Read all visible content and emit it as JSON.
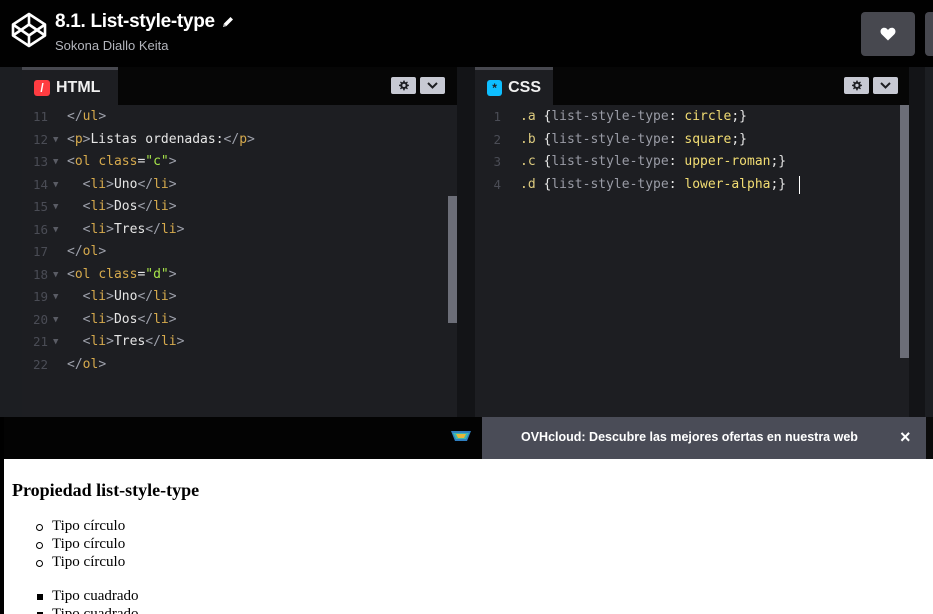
{
  "header": {
    "title": "8.1. List-style-type",
    "author": "Sokona Diallo Keita",
    "heart_icon": "heart-icon",
    "edit_icon": "pencil-icon"
  },
  "html_pane": {
    "tab_label": "HTML",
    "lines": [
      {
        "n": "11",
        "fold": false,
        "tokens": [
          {
            "t": "tag",
            "v": "</"
          },
          {
            "t": "name",
            "v": "ul"
          },
          {
            "t": "tag",
            "v": ">"
          }
        ]
      },
      {
        "n": "12",
        "fold": true,
        "tokens": [
          {
            "t": "tag",
            "v": "<"
          },
          {
            "t": "name",
            "v": "p"
          },
          {
            "t": "tag",
            "v": ">"
          },
          {
            "t": "plain",
            "v": "Listas ordenadas:"
          },
          {
            "t": "tag",
            "v": "</"
          },
          {
            "t": "name",
            "v": "p"
          },
          {
            "t": "tag",
            "v": ">"
          }
        ]
      },
      {
        "n": "13",
        "fold": true,
        "tokens": [
          {
            "t": "tag",
            "v": "<"
          },
          {
            "t": "name",
            "v": "ol"
          },
          {
            "t": "plain",
            "v": " "
          },
          {
            "t": "attr",
            "v": "class"
          },
          {
            "t": "plain",
            "v": "="
          },
          {
            "t": "str",
            "v": "\"c\""
          },
          {
            "t": "tag",
            "v": ">"
          }
        ]
      },
      {
        "n": "14",
        "fold": true,
        "tokens": [
          {
            "t": "plain",
            "v": "  "
          },
          {
            "t": "tag",
            "v": "<"
          },
          {
            "t": "name",
            "v": "li"
          },
          {
            "t": "tag",
            "v": ">"
          },
          {
            "t": "plain",
            "v": "Uno"
          },
          {
            "t": "tag",
            "v": "</"
          },
          {
            "t": "name",
            "v": "li"
          },
          {
            "t": "tag",
            "v": ">"
          }
        ]
      },
      {
        "n": "15",
        "fold": true,
        "tokens": [
          {
            "t": "plain",
            "v": "  "
          },
          {
            "t": "tag",
            "v": "<"
          },
          {
            "t": "name",
            "v": "li"
          },
          {
            "t": "tag",
            "v": ">"
          },
          {
            "t": "plain",
            "v": "Dos"
          },
          {
            "t": "tag",
            "v": "</"
          },
          {
            "t": "name",
            "v": "li"
          },
          {
            "t": "tag",
            "v": ">"
          }
        ]
      },
      {
        "n": "16",
        "fold": true,
        "tokens": [
          {
            "t": "plain",
            "v": "  "
          },
          {
            "t": "tag",
            "v": "<"
          },
          {
            "t": "name",
            "v": "li"
          },
          {
            "t": "tag",
            "v": ">"
          },
          {
            "t": "plain",
            "v": "Tres"
          },
          {
            "t": "tag",
            "v": "</"
          },
          {
            "t": "name",
            "v": "li"
          },
          {
            "t": "tag",
            "v": ">"
          }
        ]
      },
      {
        "n": "17",
        "fold": false,
        "tokens": [
          {
            "t": "tag",
            "v": "</"
          },
          {
            "t": "name",
            "v": "ol"
          },
          {
            "t": "tag",
            "v": ">"
          }
        ]
      },
      {
        "n": "18",
        "fold": true,
        "tokens": [
          {
            "t": "tag",
            "v": "<"
          },
          {
            "t": "name",
            "v": "ol"
          },
          {
            "t": "plain",
            "v": " "
          },
          {
            "t": "attr",
            "v": "class"
          },
          {
            "t": "plain",
            "v": "="
          },
          {
            "t": "str",
            "v": "\"d\""
          },
          {
            "t": "tag",
            "v": ">"
          }
        ]
      },
      {
        "n": "19",
        "fold": true,
        "tokens": [
          {
            "t": "plain",
            "v": "  "
          },
          {
            "t": "tag",
            "v": "<"
          },
          {
            "t": "name",
            "v": "li"
          },
          {
            "t": "tag",
            "v": ">"
          },
          {
            "t": "plain",
            "v": "Uno"
          },
          {
            "t": "tag",
            "v": "</"
          },
          {
            "t": "name",
            "v": "li"
          },
          {
            "t": "tag",
            "v": ">"
          }
        ]
      },
      {
        "n": "20",
        "fold": true,
        "tokens": [
          {
            "t": "plain",
            "v": "  "
          },
          {
            "t": "tag",
            "v": "<"
          },
          {
            "t": "name",
            "v": "li"
          },
          {
            "t": "tag",
            "v": ">"
          },
          {
            "t": "plain",
            "v": "Dos"
          },
          {
            "t": "tag",
            "v": "</"
          },
          {
            "t": "name",
            "v": "li"
          },
          {
            "t": "tag",
            "v": ">"
          }
        ]
      },
      {
        "n": "21",
        "fold": true,
        "tokens": [
          {
            "t": "plain",
            "v": "  "
          },
          {
            "t": "tag",
            "v": "<"
          },
          {
            "t": "name",
            "v": "li"
          },
          {
            "t": "tag",
            "v": ">"
          },
          {
            "t": "plain",
            "v": "Tres"
          },
          {
            "t": "tag",
            "v": "</"
          },
          {
            "t": "name",
            "v": "li"
          },
          {
            "t": "tag",
            "v": ">"
          }
        ]
      },
      {
        "n": "22",
        "fold": false,
        "tokens": [
          {
            "t": "tag",
            "v": "</"
          },
          {
            "t": "name",
            "v": "ol"
          },
          {
            "t": "tag",
            "v": ">"
          }
        ]
      }
    ]
  },
  "css_pane": {
    "tab_label": "CSS",
    "lines": [
      {
        "n": "1",
        "tokens": [
          {
            "t": "sel",
            "v": ".a"
          },
          {
            "t": "plain",
            "v": " {"
          },
          {
            "t": "prop",
            "v": "list-style-type"
          },
          {
            "t": "plain",
            "v": ": "
          },
          {
            "t": "val",
            "v": "circle"
          },
          {
            "t": "plain",
            "v": ";}"
          }
        ]
      },
      {
        "n": "2",
        "tokens": [
          {
            "t": "sel",
            "v": ".b"
          },
          {
            "t": "plain",
            "v": " {"
          },
          {
            "t": "prop",
            "v": "list-style-type"
          },
          {
            "t": "plain",
            "v": ": "
          },
          {
            "t": "val",
            "v": "square"
          },
          {
            "t": "plain",
            "v": ";}"
          }
        ]
      },
      {
        "n": "3",
        "tokens": [
          {
            "t": "sel",
            "v": ".c"
          },
          {
            "t": "plain",
            "v": " {"
          },
          {
            "t": "prop",
            "v": "list-style-type"
          },
          {
            "t": "plain",
            "v": ": "
          },
          {
            "t": "val",
            "v": "upper-roman"
          },
          {
            "t": "plain",
            "v": ";}"
          }
        ]
      },
      {
        "n": "4",
        "tokens": [
          {
            "t": "sel",
            "v": ".d"
          },
          {
            "t": "plain",
            "v": " {"
          },
          {
            "t": "prop",
            "v": "list-style-type"
          },
          {
            "t": "plain",
            "v": ": "
          },
          {
            "t": "val",
            "v": "lower-alpha"
          },
          {
            "t": "plain",
            "v": ";}"
          }
        ]
      }
    ]
  },
  "ad": {
    "text": "OVHcloud: Descubre las mejores ofertas en nuestra web",
    "close": "×"
  },
  "preview": {
    "heading": "Propiedad list-style-type",
    "circle_items": [
      "Tipo círculo",
      "Tipo círculo",
      "Tipo círculo"
    ],
    "square_items": [
      "Tipo cuadrado",
      "Tipo cuadrado"
    ]
  },
  "colors": {
    "html_icon": "#ff3c41",
    "css_icon": "#0ebeff",
    "header_bg": "#010101",
    "button_bg": "#47484f"
  }
}
